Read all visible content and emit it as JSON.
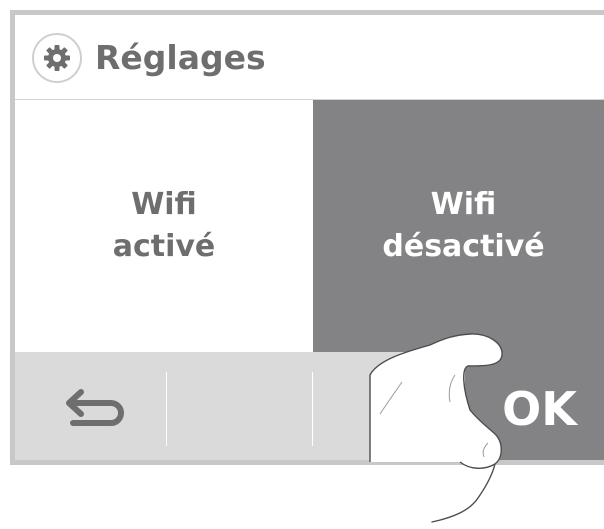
{
  "header": {
    "icon": "gear-icon",
    "title": "Réglages"
  },
  "options": {
    "wifi_on": {
      "line1": "Wifi",
      "line2": "activé",
      "selected": false
    },
    "wifi_off": {
      "line1": "Wifi",
      "line2": "désactivé",
      "selected": true
    }
  },
  "footer": {
    "back_icon": "return-arrow-icon",
    "ok_label": "OK"
  },
  "colors": {
    "selected_bg": "#838386",
    "text_gray": "#6e6e6e",
    "footer_bg": "#dadada",
    "frame": "#c8c8c8"
  }
}
